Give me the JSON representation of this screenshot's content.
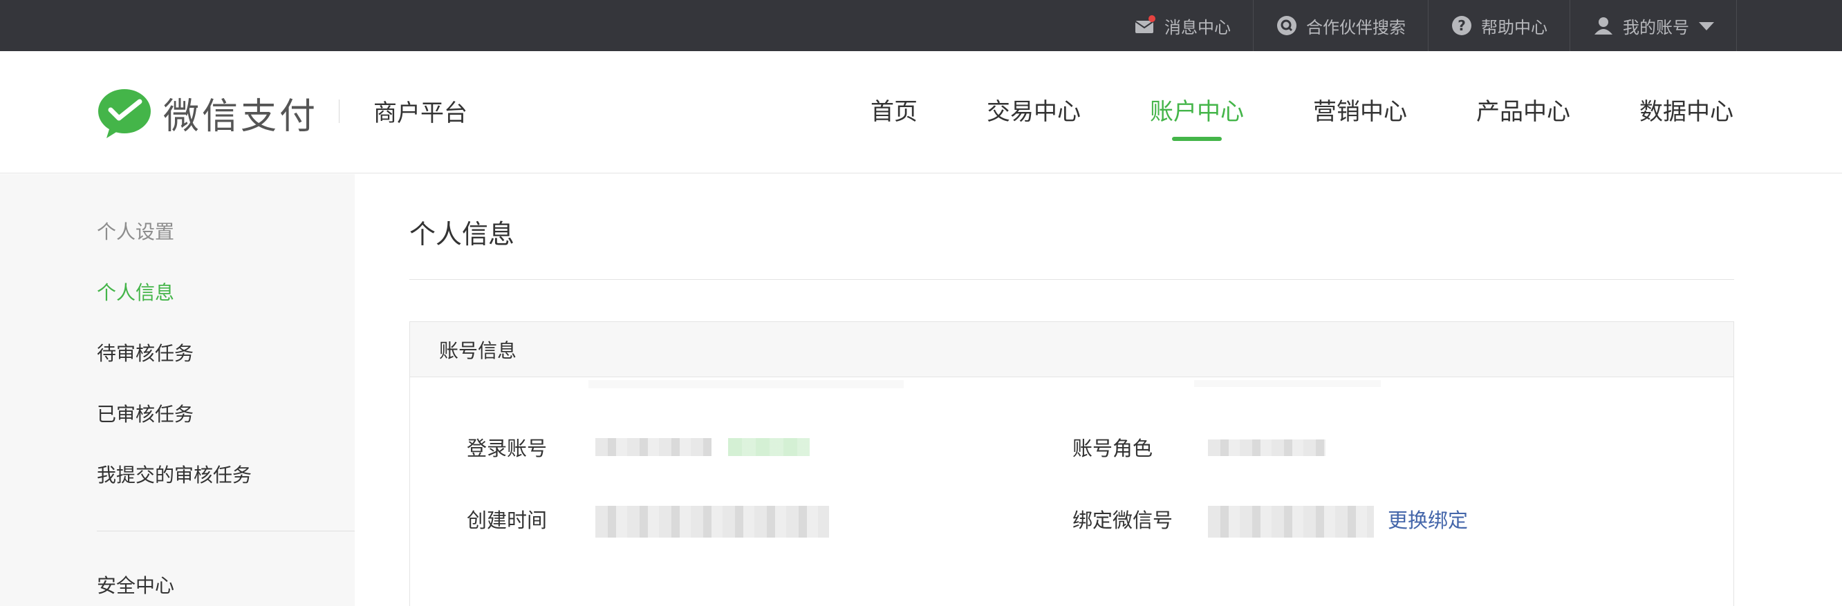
{
  "topbar": {
    "items": [
      {
        "label": "消息中心",
        "icon": "mail-icon"
      },
      {
        "label": "合作伙伴搜索",
        "icon": "search-icon"
      },
      {
        "label": "帮助中心",
        "icon": "help-icon"
      },
      {
        "label": "我的账号",
        "icon": "user-icon"
      }
    ]
  },
  "brand": {
    "logo_text": "微信支付",
    "platform": "商户平台",
    "accent_color": "#44b549"
  },
  "nav": {
    "items": [
      "首页",
      "交易中心",
      "账户中心",
      "营销中心",
      "产品中心",
      "数据中心"
    ],
    "active": "账户中心"
  },
  "sidebar": {
    "group_title": "个人设置",
    "items": [
      "个人信息",
      "待审核任务",
      "已审核任务",
      "我提交的审核任务"
    ],
    "section2": "安全中心"
  },
  "main": {
    "title": "个人信息",
    "panel_title": "账号信息",
    "fields": {
      "login_account_label": "登录账号",
      "account_role_label": "账号角色",
      "created_time_label": "创建时间",
      "bound_wechat_label": "绑定微信号",
      "change_binding_link": "更换绑定"
    }
  }
}
